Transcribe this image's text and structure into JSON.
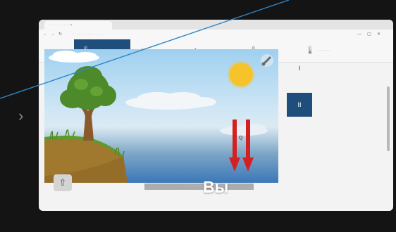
{
  "browser": {
    "tab_title": "· · · · · · · · · · ×",
    "url": "· · · · · · · · · · · · · ·",
    "window_controls": [
      "—",
      "▢",
      "✕"
    ]
  },
  "toolbar": {
    "tabs": [
      {
        "label": "· · · · ·",
        "icon": "thermometer-icon",
        "glyph": "🌡",
        "active": true
      },
      {
        "label": "· · · · · ·",
        "icon": "heater-icon",
        "glyph": "♨",
        "active": false
      },
      {
        "label": "· · · · · · ·",
        "icon": "drop-icon",
        "glyph": "△",
        "active": false
      },
      {
        "label": "· · · · · ·",
        "icon": "thermometer-icon",
        "glyph": "🌡",
        "active": false
      },
      {
        "label": "· · · · · ·",
        "icon": "thermometer-icon",
        "glyph": "🌡",
        "active": false
      }
    ]
  },
  "side_panel": {
    "button_1_label": "I",
    "button_2_label": "II"
  },
  "scene": {
    "arrow_label": "Q"
  },
  "caption": {
    "strip_text": "· · · · · · · · · · · · · · · ·",
    "subtitle": "Вы"
  },
  "colors": {
    "toolbar_active": "#1f4e7c",
    "sun": "#f6c52a",
    "arrow": "#d42020",
    "ground": "#a0782e"
  }
}
